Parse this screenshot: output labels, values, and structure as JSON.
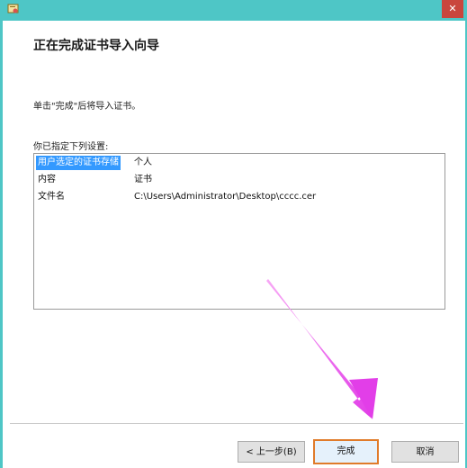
{
  "window": {
    "close_label": "✕",
    "accent": "#4ec6c6"
  },
  "wizard": {
    "heading": "正在完成证书导入向导",
    "instruction": "单击\"完成\"后将导入证书。",
    "list_label": "你已指定下列设置:",
    "settings": [
      {
        "key": "用户选定的证书存储",
        "value": "个人",
        "selected": true
      },
      {
        "key": "内容",
        "value": "证书",
        "selected": false
      },
      {
        "key": "文件名",
        "value": "C:\\Users\\Administrator\\Desktop\\cccc.cer",
        "selected": false
      }
    ]
  },
  "buttons": {
    "back_label": "< 上一步(B)",
    "finish_label": "完成",
    "cancel_label": "取消"
  },
  "annotation": {
    "arrow_color": "#e23ee8"
  }
}
